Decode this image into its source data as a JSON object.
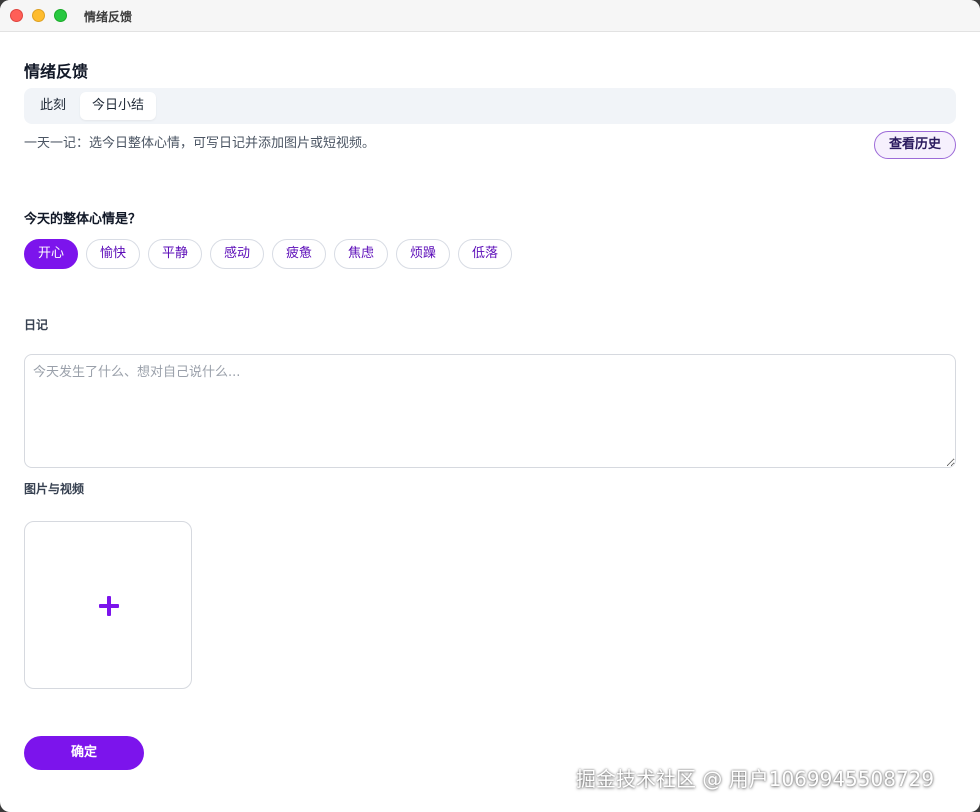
{
  "window": {
    "title": "情绪反馈"
  },
  "page": {
    "title": "情绪反馈"
  },
  "tabs": [
    {
      "label": "此刻",
      "active": false
    },
    {
      "label": "今日小结",
      "active": true
    }
  ],
  "description": "一天一记：选今日整体心情，可写日记并添加图片或短视频。",
  "history_button": "查看历史",
  "mood": {
    "question": "今天的整体心情是？",
    "options": [
      "开心",
      "愉快",
      "平静",
      "感动",
      "疲惫",
      "焦虑",
      "烦躁",
      "低落"
    ],
    "selected": "开心"
  },
  "diary": {
    "label": "日记",
    "placeholder": "今天发生了什么、想对自己说什么...",
    "value": ""
  },
  "media": {
    "label": "图片与视频",
    "add_icon": "plus-icon"
  },
  "submit_button": "确定",
  "watermark": "掘金技术社区 @ 用户1069945508729",
  "colors": {
    "accent": "#7c14ec",
    "accent_text": "#5b0bb8",
    "tab_bar_bg": "#f1f4f8"
  }
}
